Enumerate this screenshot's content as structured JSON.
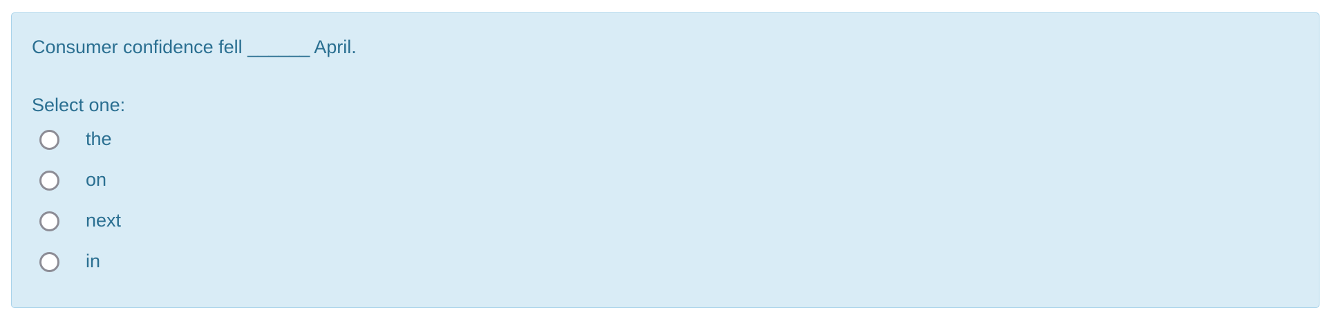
{
  "question": {
    "text": "Consumer confidence fell ______ April.",
    "prompt": "Select one:",
    "options": [
      {
        "label": "the",
        "selected": false
      },
      {
        "label": "on",
        "selected": false
      },
      {
        "label": "next",
        "selected": false
      },
      {
        "label": "in",
        "selected": false
      }
    ]
  },
  "colors": {
    "panel_background": "#d9ecf6",
    "panel_border": "#a9d3ea",
    "text": "#2a6f91",
    "radio_border": "#8c8c95"
  }
}
